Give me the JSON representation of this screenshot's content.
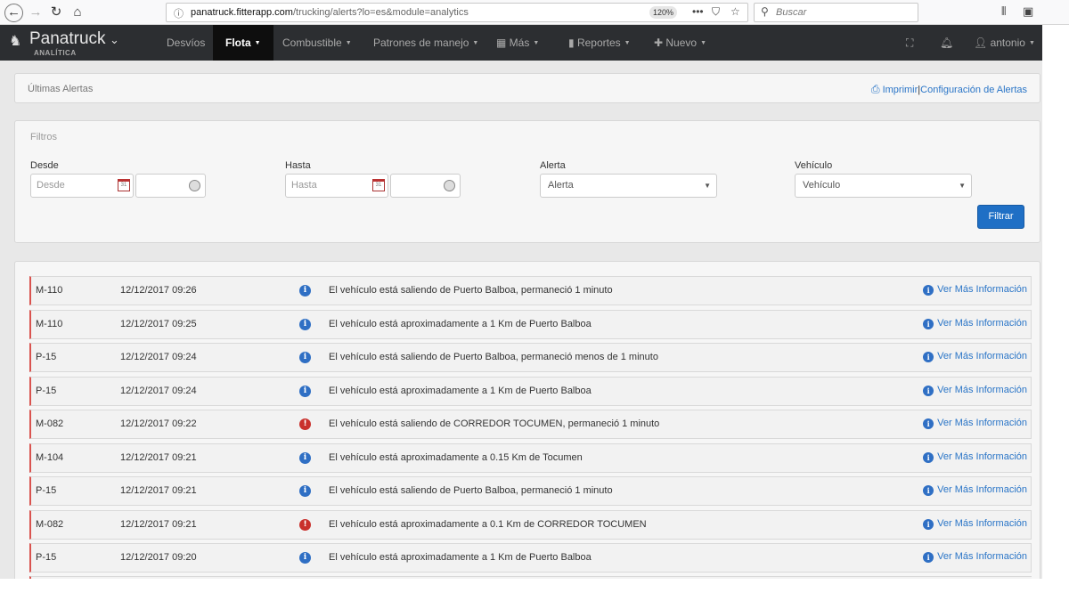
{
  "browser": {
    "url_host": "panatruck.fitterapp.com",
    "url_path": "/trucking/alerts?lo=es&module=analytics",
    "zoom": "120%",
    "search_placeholder": "Buscar"
  },
  "nav": {
    "brand": "Panatruck",
    "brand_sub": "ANALÍTICA",
    "items": [
      {
        "label": "Desvíos"
      },
      {
        "label": "Flota"
      },
      {
        "label": "Combustible"
      },
      {
        "label": "Patrones de manejo"
      },
      {
        "label": "Más"
      },
      {
        "label": "Reportes"
      },
      {
        "label": "Nuevo"
      }
    ],
    "user": "antonio"
  },
  "header": {
    "title": "Últimas Alertas",
    "print": "Imprimir",
    "separator": "|",
    "config": "Configuración de Alertas"
  },
  "filters": {
    "title": "Filtros",
    "from_label": "Desde",
    "from_placeholder": "Desde",
    "to_label": "Hasta",
    "to_placeholder": "Hasta",
    "alert_label": "Alerta",
    "alert_value": "Alerta",
    "vehicle_label": "Vehículo",
    "vehicle_value": "Vehículo",
    "button": "Filtrar"
  },
  "alerts": {
    "more_label": "Ver Más Información",
    "rows": [
      {
        "unit": "M-110",
        "time": "12/12/2017 09:26",
        "level": "info",
        "message": "El vehículo está saliendo de Puerto Balboa, permaneció 1 minuto"
      },
      {
        "unit": "M-110",
        "time": "12/12/2017 09:25",
        "level": "info",
        "message": "El vehículo está aproximadamente a 1 Km de Puerto Balboa"
      },
      {
        "unit": "P-15",
        "time": "12/12/2017 09:24",
        "level": "info",
        "message": "El vehículo está saliendo de Puerto Balboa, permaneció menos de 1 minuto"
      },
      {
        "unit": "P-15",
        "time": "12/12/2017 09:24",
        "level": "info",
        "message": "El vehículo está aproximadamente a 1 Km de Puerto Balboa"
      },
      {
        "unit": "M-082",
        "time": "12/12/2017 09:22",
        "level": "danger",
        "message": "El vehículo está saliendo de CORREDOR TOCUMEN, permaneció 1 minuto"
      },
      {
        "unit": "M-104",
        "time": "12/12/2017 09:21",
        "level": "info",
        "message": "El vehículo está aproximadamente a 0.15 Km de Tocumen"
      },
      {
        "unit": "P-15",
        "time": "12/12/2017 09:21",
        "level": "info",
        "message": "El vehículo está saliendo de Puerto Balboa, permaneció 1 minuto"
      },
      {
        "unit": "M-082",
        "time": "12/12/2017 09:21",
        "level": "danger",
        "message": "El vehículo está aproximadamente a 0.1 Km de CORREDOR TOCUMEN"
      },
      {
        "unit": "P-15",
        "time": "12/12/2017 09:20",
        "level": "info",
        "message": "El vehículo está aproximadamente a 1 Km de Puerto Balboa"
      }
    ]
  }
}
